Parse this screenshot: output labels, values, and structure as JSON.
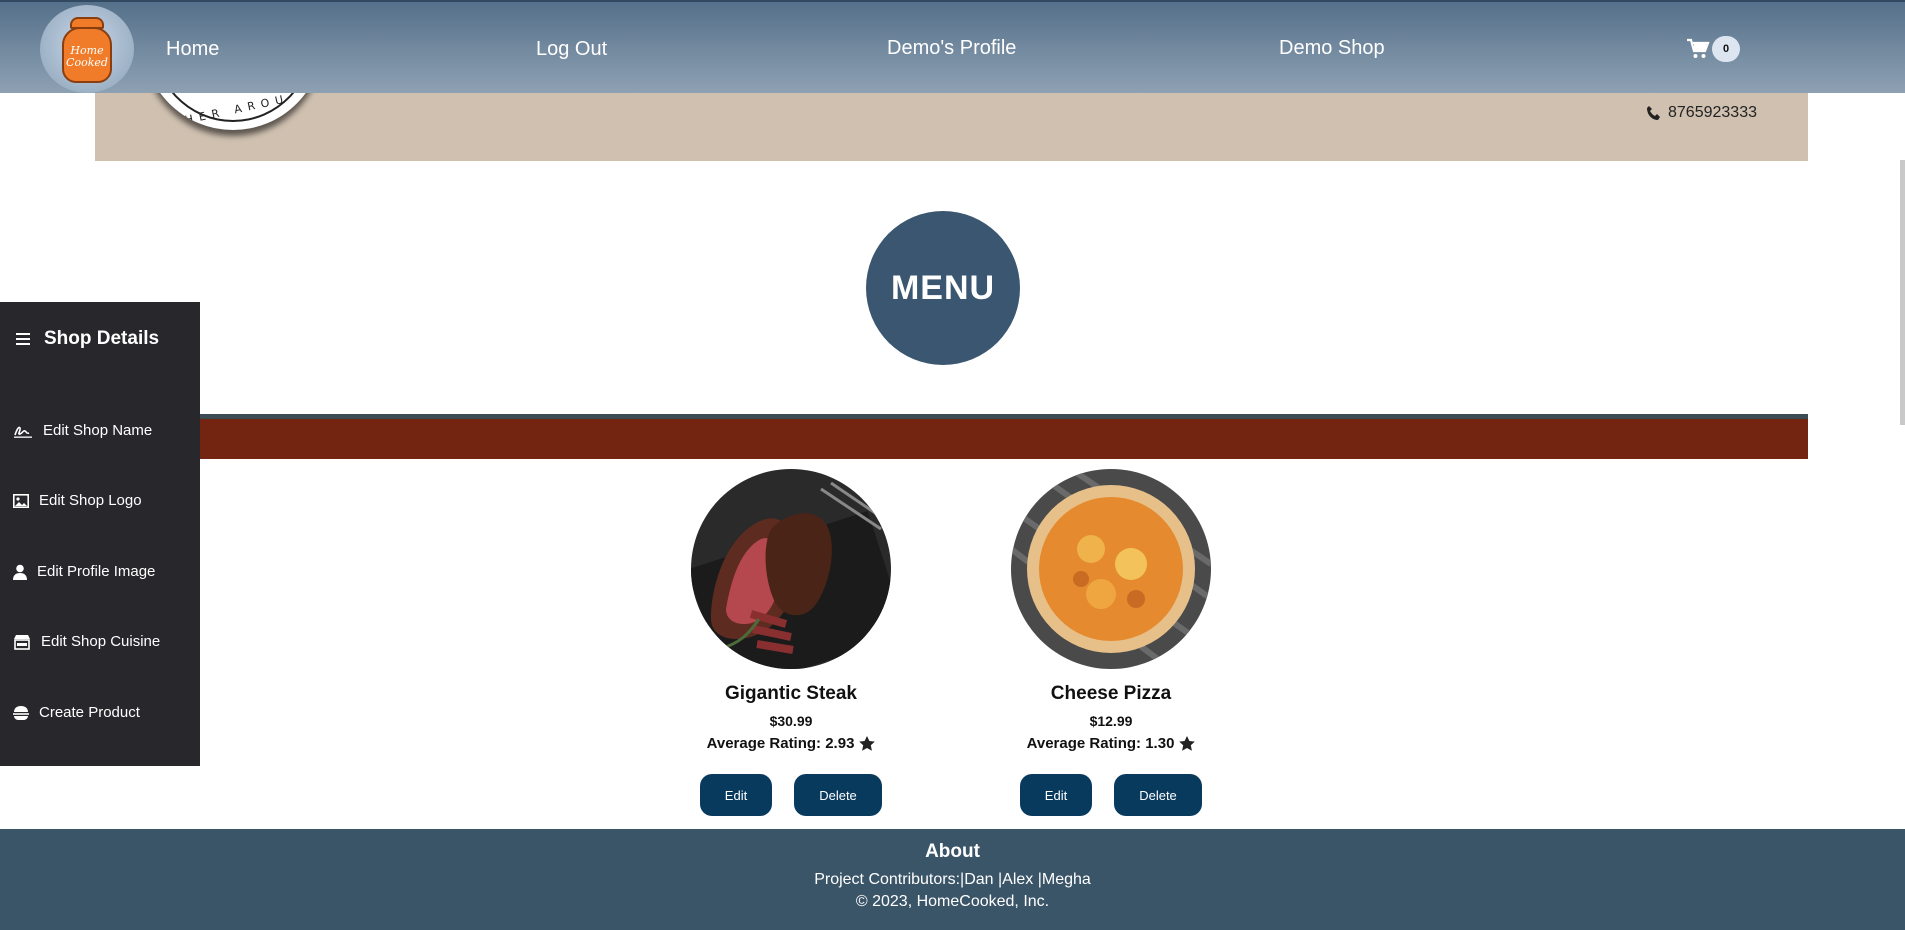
{
  "nav": {
    "logo_text": "Home Cooked",
    "links": [
      "Home",
      "Log Out",
      "Demo's Profile",
      "Demo Shop"
    ],
    "cart_count": "0"
  },
  "banner": {
    "seal_text": "THER AROU",
    "phone": "8765923333"
  },
  "menu_title": "MENU",
  "sidebar": {
    "title": "Shop Details",
    "items": [
      {
        "label": "Edit Shop Name",
        "icon": "signature-icon"
      },
      {
        "label": "Edit Shop Logo",
        "icon": "image-icon"
      },
      {
        "label": "Edit Profile Image",
        "icon": "user-icon"
      },
      {
        "label": "Edit Shop Cuisine",
        "icon": "store-icon"
      },
      {
        "label": "Create Product",
        "icon": "burger-icon"
      }
    ]
  },
  "products": [
    {
      "name": "Gigantic Steak",
      "price": "$30.99",
      "rating": "Average Rating: 2.93",
      "edit": "Edit",
      "delete": "Delete"
    },
    {
      "name": "Cheese Pizza",
      "price": "$12.99",
      "rating": "Average Rating: 1.30",
      "edit": "Edit",
      "delete": "Delete"
    }
  ],
  "footer": {
    "about": "About",
    "contributors": "Project Contributors:|Dan |Alex |Megha",
    "copyright": "© 2023, HomeCooked, Inc."
  },
  "colors": {
    "nav": "#6f869c",
    "banner": "#cfc0b0",
    "strip": "#732511",
    "sidebar": "#27272c",
    "button": "#083a5e",
    "footer": "#3a5468"
  }
}
